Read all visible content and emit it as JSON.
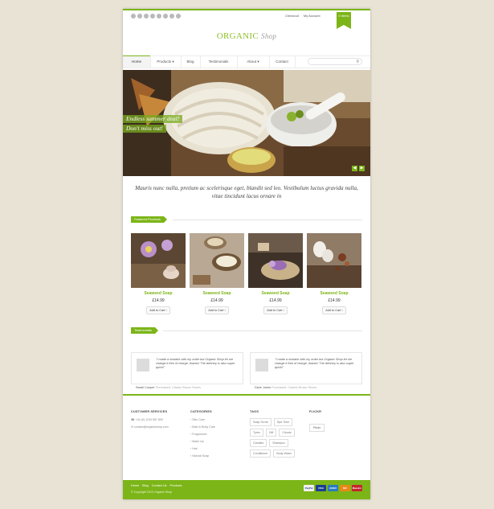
{
  "top": {
    "social_icons": [
      "facebook-icon",
      "twitter-icon",
      "google-plus-icon",
      "linkedin-icon",
      "rss-icon",
      "pinterest-icon",
      "vimeo-icon",
      "flickr-icon"
    ],
    "checkout": "Checkout",
    "account": "My Account",
    "cart": "0 items"
  },
  "logo": {
    "main": "ORGANIC",
    "sub": "Shop"
  },
  "nav": {
    "items": [
      "Home",
      "Products ▾",
      "Blog",
      "Testimonials",
      "About ▾",
      "Contact"
    ],
    "search_placeholder": ""
  },
  "slider": {
    "line1": "Endless summer deal!",
    "line2": "Don't miss out!"
  },
  "intro": "Mauris nunc nulla, pretium ac scelerisque eget, blandit sed leo. Vestibulum luctus gravida nulla, vitae tincidunt lacus ornare in",
  "featured": {
    "title": "Featured Products",
    "products": [
      {
        "name": "Seaweed Soap",
        "price": "£14.99",
        "button": "Add to Cart ›"
      },
      {
        "name": "Seaweed Soap",
        "price": "£14.99",
        "button": "Add to Cart ›"
      },
      {
        "name": "Seaweed Soap",
        "price": "£14.99",
        "button": "Add to Cart ›"
      },
      {
        "name": "Seaweed Soap",
        "price": "£14.99",
        "button": "Add to Cart ›"
      }
    ]
  },
  "testimonials": {
    "title": "Testimonials",
    "items": [
      {
        "quote": "\"I made a mistake with my order but Organic Shop let me change it free of charge, thanks! The delivery is also super quick!\"",
        "name": "Sarah Cooper",
        "product": "Purchased: Classic Brown Shoes"
      },
      {
        "quote": "\"I made a mistake with my order but Organic Shop let me change it free of charge, thanks! The delivery is also super quick!\"",
        "name": "Dave Jones",
        "product": "Purchased: Classic Brown Shoes"
      }
    ]
  },
  "footer": {
    "customer_services": {
      "title": "CUSTOMER SERVICES",
      "phone": "+44 (0) 1234 567 890",
      "email": "contact@organicshop.com"
    },
    "categories": {
      "title": "CATEGORIES",
      "items": [
        "Skin Care",
        "Bath & Body Care",
        "Fragrances",
        "Make Up",
        "Hair",
        "Natural Soap"
      ]
    },
    "tags": {
      "title": "TAGS",
      "items": [
        "Soap Scrub",
        "Spa Time",
        "Tyres",
        "Gift",
        "Clouds",
        "Candles",
        "Shampoo",
        "Conditioner",
        "Body Wash"
      ]
    },
    "flickr": {
      "title": "FLICKR",
      "button": "Flickr"
    },
    "bottom_links": [
      "Home",
      "Blog",
      "Contact Us",
      "Products"
    ],
    "copyright": "© Copyright 2013 Organic Shop",
    "payments": [
      "PayPal",
      "VISA",
      "AMEX",
      "MC",
      "Maestro"
    ]
  },
  "colors": {
    "accent": "#7cb518",
    "background": "#e9e3d6"
  }
}
